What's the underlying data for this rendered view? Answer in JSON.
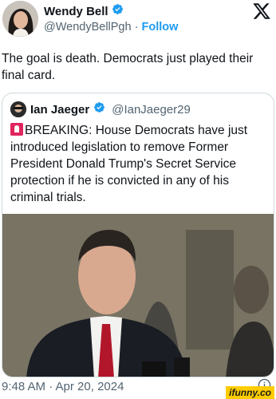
{
  "author": {
    "name": "Wendy Bell",
    "handle": "@WendyBellPgh",
    "separator": "·",
    "follow_label": "Follow"
  },
  "tweet": {
    "text": "The goal is death. Democrats just played their final card."
  },
  "quoted": {
    "name": "Ian Jaeger",
    "handle": "@IanJaeger29",
    "text": "BREAKING: House Democrats have just introduced legislation to remove Former President Donald Trump's Secret Service protection if he is convicted in any of his criminal trials."
  },
  "meta": {
    "timestamp": "9:48 AM · Apr 20, 2024"
  },
  "watermark": {
    "text": "ifunny.co"
  },
  "icons": {
    "brand": "x-logo-icon",
    "verified": "verified-badge-icon",
    "info": "info-icon",
    "breaking": "siren-icon"
  },
  "colors": {
    "accent": "#1d9bf0",
    "text": "#0f1419",
    "muted": "#536471",
    "watermark_bg": "#ffcc00"
  }
}
